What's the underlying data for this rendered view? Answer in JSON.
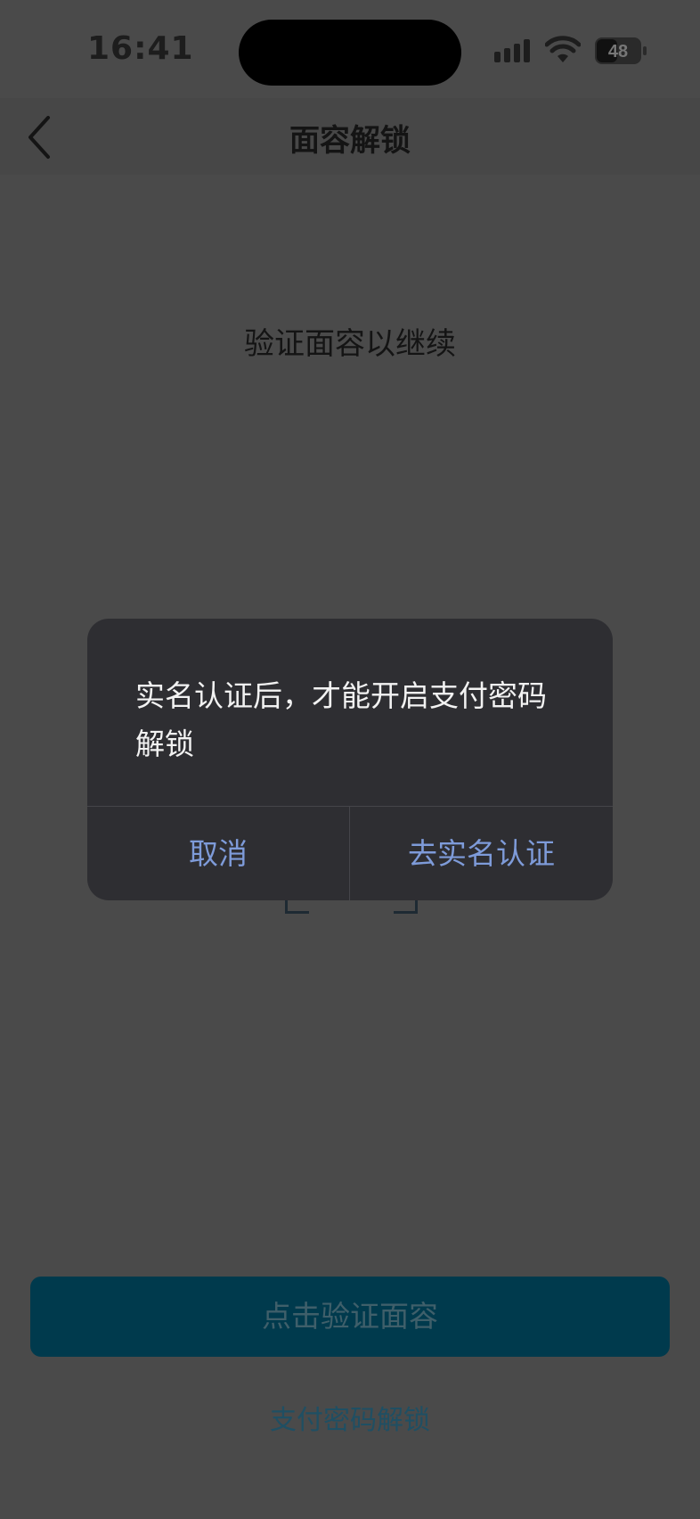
{
  "status_bar": {
    "time": "16:41",
    "battery": "48"
  },
  "nav": {
    "title": "面容解锁"
  },
  "prompt": "验证面容以继续",
  "dialog": {
    "message": "实名认证后，才能开启支付密码解锁",
    "cancel_label": "取消",
    "confirm_label": "去实名认证"
  },
  "main_button_label": "点击验证面容",
  "password_link_label": "支付密码解锁",
  "colors": {
    "overlay_bg": "#4a4a4a",
    "dialog_bg": "#2e2e32",
    "dialog_button": "#7e9bd9",
    "main_button_bg": "#003a4d"
  }
}
